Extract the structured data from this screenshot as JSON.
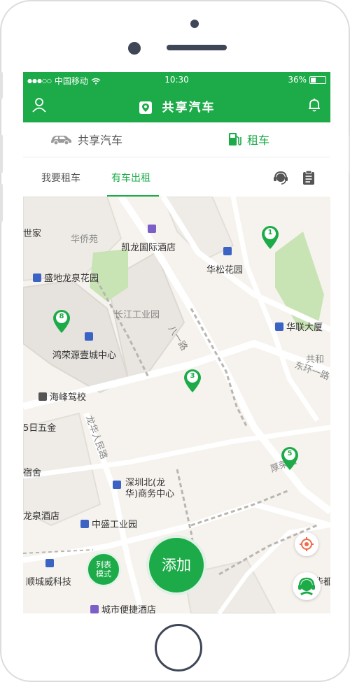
{
  "status": {
    "carrier": "中国移动",
    "time": "10:30",
    "battery": "36%",
    "battery_level": 0.36
  },
  "header": {
    "title": "共享汽车"
  },
  "modes": [
    {
      "label": "共享汽车"
    },
    {
      "label": "租车"
    }
  ],
  "subtabs": [
    {
      "label": "我要租车"
    },
    {
      "label": "有车出租"
    }
  ],
  "map": {
    "labels": {
      "shijia": "世家",
      "huaqiaoyuan": "华侨苑",
      "kailong": "凯龙国际酒店",
      "huasong": "华松花园",
      "shengdi": "盛地龙泉花园",
      "changjiang": "长江工业园",
      "hualian": "华联大厦",
      "gonghe": "共和",
      "bayilu": "八一路",
      "dongyi": "东环一路",
      "hongrongyuan": "鸿荣源壹城中心",
      "haifeng": "海峰驾校",
      "wujin": "5日五金",
      "huarenminlu": "龙华人民路",
      "sushe": "宿舍",
      "shenzhenbei": "深圳北(龙",
      "shenzhenbei2": "华)商务中心",
      "longjing": "龙泉酒店",
      "zhongsheng": "中盛工业园",
      "shunchengwei": "顺城威科技",
      "chengshi": "城市便捷酒店",
      "houyilu": "厚荣路",
      "huadu": "华都"
    },
    "pins": [
      "1",
      "8",
      "3",
      "5"
    ]
  },
  "buttons": {
    "list_mode_line1": "列表",
    "list_mode_line2": "模式",
    "add": "添加"
  }
}
